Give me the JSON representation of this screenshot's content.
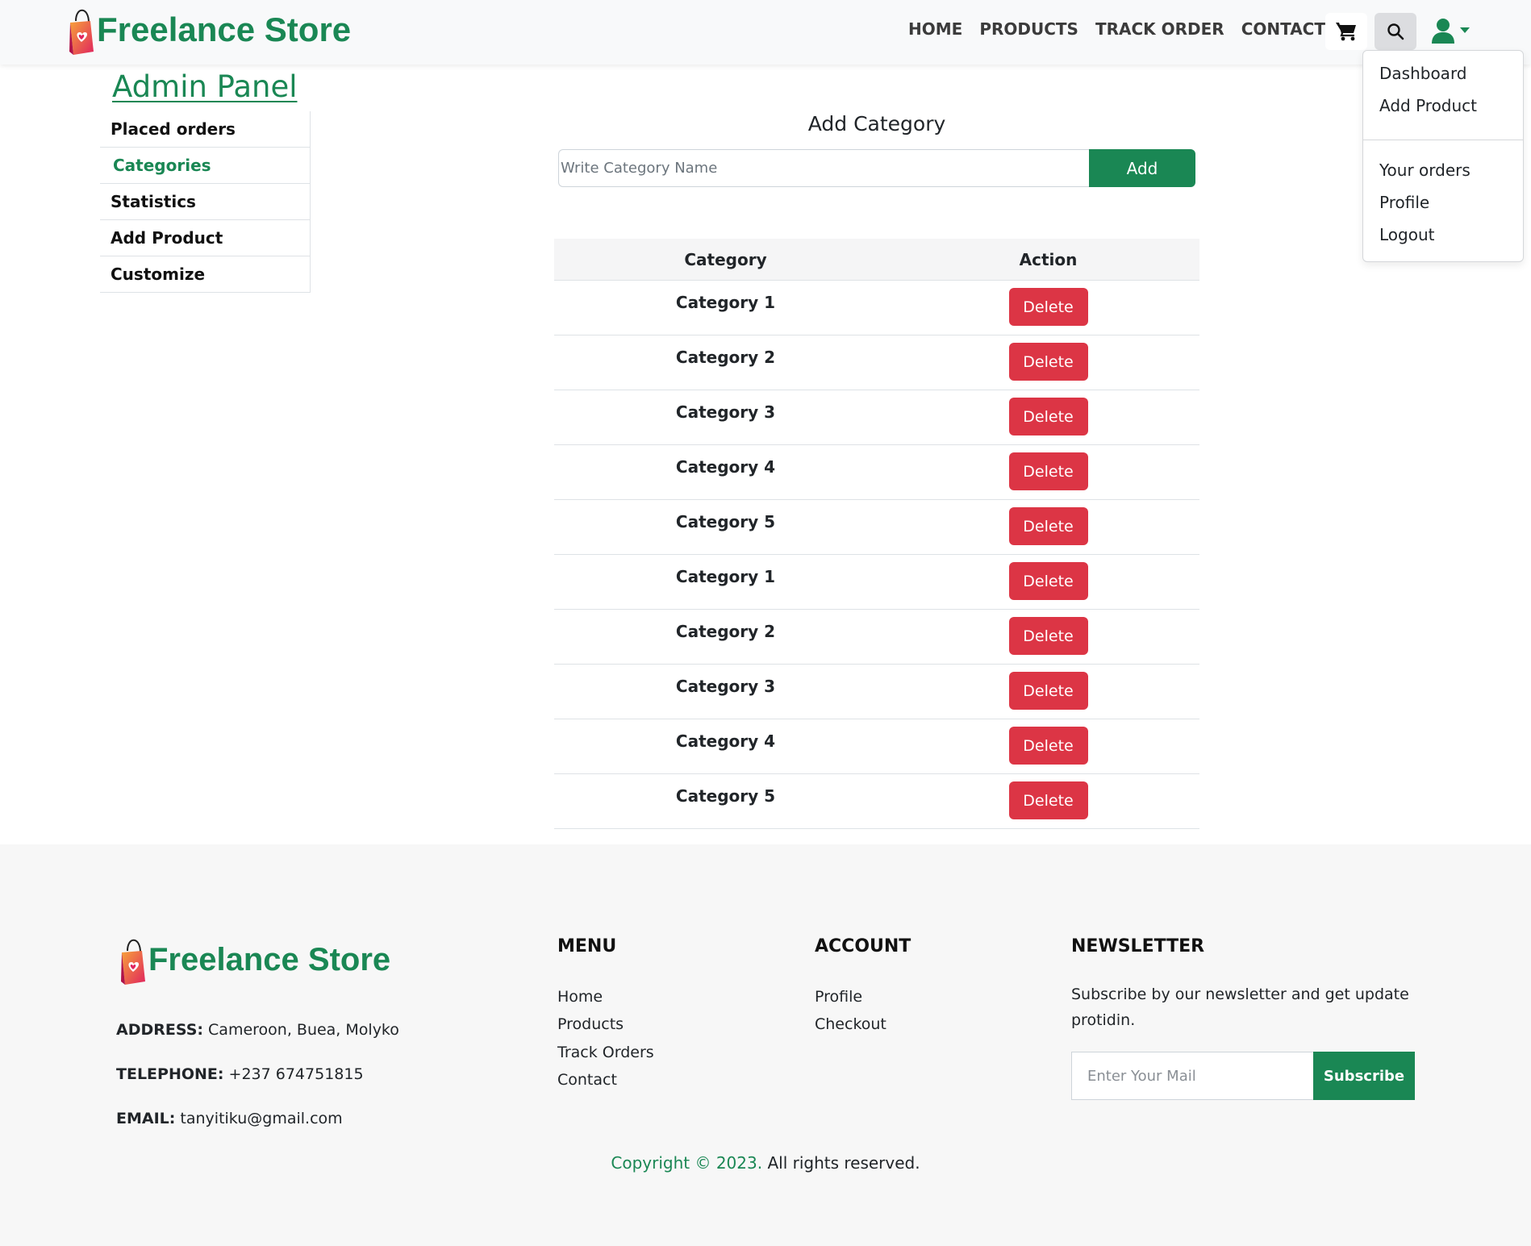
{
  "brand": {
    "name": "Freelance Store",
    "color": "#1a8754"
  },
  "nav": {
    "items": [
      "HOME",
      "PRODUCTS",
      "TRACK ORDER",
      "CONTACT"
    ],
    "icons": {
      "cart": "cart-icon",
      "search": "search-icon",
      "user": "user-icon"
    }
  },
  "user_menu": {
    "items": [
      "Dashboard",
      "Add Product",
      "Your orders",
      "Profile",
      "Logout"
    ]
  },
  "admin": {
    "title": "Admin Panel",
    "menu": [
      "Placed orders",
      "Categories",
      "Statistics",
      "Add Product",
      "Customize"
    ],
    "active": "Categories"
  },
  "add_category": {
    "title": "Add Category",
    "input_placeholder": "Write Category Name",
    "button": "Add"
  },
  "table": {
    "headers": [
      "Category",
      "Action"
    ],
    "rows": [
      "Category 1",
      "Category 2",
      "Category 3",
      "Category 4",
      "Category 5",
      "Category 1",
      "Category 2",
      "Category 3",
      "Category 4",
      "Category 5"
    ],
    "action_label": "Delete"
  },
  "footer": {
    "address_label": "ADDRESS:",
    "address": "Cameroon, Buea, Molyko",
    "telephone_label": "TELEPHONE:",
    "telephone": "+237 674751815",
    "email_label": "EMAIL:",
    "email": "tanyitiku@gmail.com",
    "menu_title": "MENU",
    "menu": [
      "Home",
      "Products",
      "Track Orders",
      "Contact"
    ],
    "account_title": "ACCOUNT",
    "account": [
      "Profile",
      "Checkout"
    ],
    "newsletter_title": "NEWSLETTER",
    "newsletter_text": "Subscribe by our newsletter and get update protidin.",
    "mail_placeholder": "Enter Your Mail",
    "subscribe": "Subscribe",
    "copyright_green": "Copyright © 2023.",
    "copyright_rest": " All rights reserved."
  },
  "colors": {
    "primary": "#1a8754",
    "danger": "#dc3545",
    "header_bg": "#f8f9fa",
    "footer_bg": "#f7f7f7"
  }
}
